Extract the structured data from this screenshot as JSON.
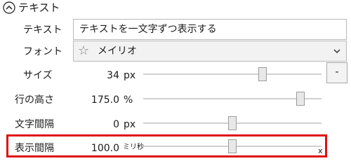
{
  "section": {
    "title": "テキスト"
  },
  "text_field": {
    "label": "テキスト",
    "value": "テキストを一文字ずつ表示する"
  },
  "font_field": {
    "label": "フォント",
    "value": "メイリオ",
    "icon": "star-icon"
  },
  "size": {
    "label": "サイズ",
    "value": "34",
    "unit": "px",
    "level": 0.67
  },
  "line_height": {
    "label": "行の高さ",
    "value": "175.0",
    "unit": "%",
    "level": 0.88
  },
  "letter_spacing": {
    "label": "文字間隔",
    "value": "0",
    "unit": "px",
    "level": 0.5
  },
  "display_interval": {
    "label": "表示間隔",
    "value": "100.0",
    "unit": "ミリ秒",
    "level": 0.5
  },
  "minus_button": {
    "label": "-"
  },
  "overlay": {
    "x_mark": "x",
    "highlight_color": "#e01010"
  }
}
